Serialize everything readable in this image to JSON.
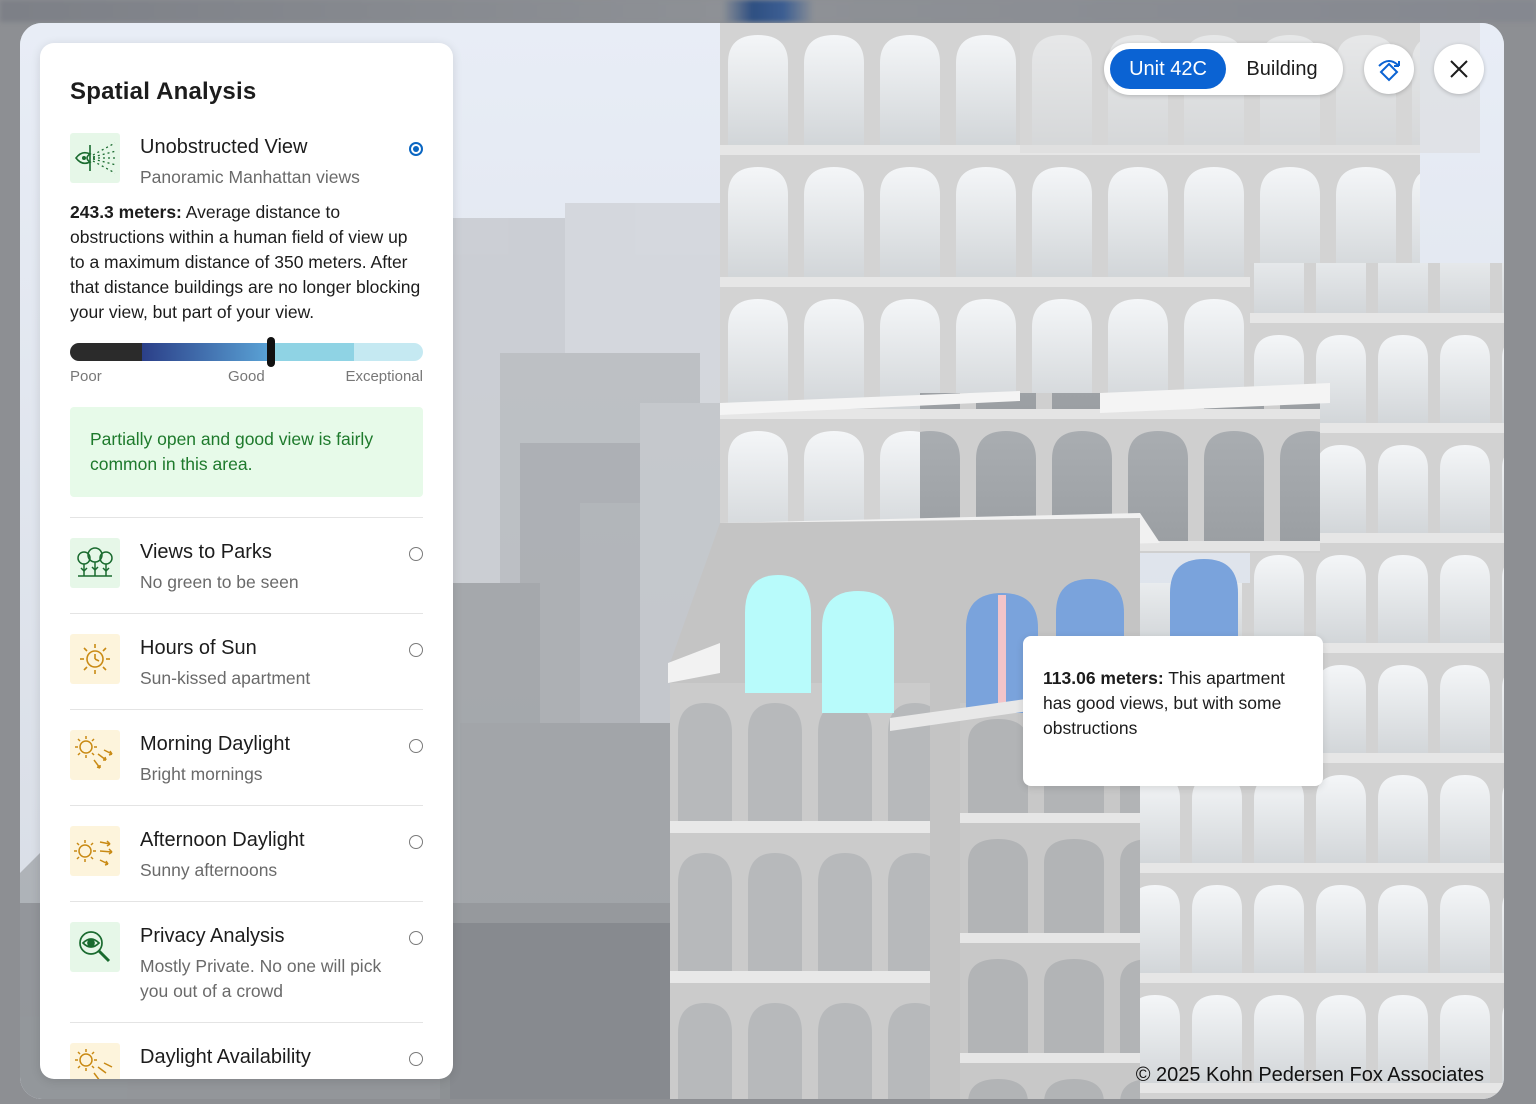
{
  "panel": {
    "title": "Spatial Analysis",
    "selected": {
      "label": "Unobstructed View",
      "sub": "Panoramic Manhattan views",
      "icon": "eye-view-icon",
      "metric": "243.3 meters:",
      "description": " Average distance to obstructions within a human field of view up to a maximum distance of 350 meters. After that distance buildings are no longer blocking your view, but part of your view.",
      "scale": {
        "labels": [
          "Poor",
          "Good",
          "Exceptional"
        ],
        "level_fraction": 0.57,
        "colors": [
          "#2b2b2b",
          "#2e4a9a",
          "#5aa3d6",
          "#8fd3e4",
          "#c5e9f2"
        ]
      },
      "note": "Partially open and good view is fairly common in this area."
    },
    "items": [
      {
        "label": "Views to Parks",
        "sub": "No green to be seen",
        "icon": "trees-icon"
      },
      {
        "label": "Hours of Sun",
        "sub": "Sun-kissed apartment",
        "icon": "sun-icon"
      },
      {
        "label": "Morning Daylight",
        "sub": "Bright mornings",
        "icon": "sun-rays-icon"
      },
      {
        "label": "Afternoon Daylight",
        "sub": "Sunny afternoons",
        "icon": "sun-rays-icon"
      },
      {
        "label": "Privacy Analysis",
        "sub": "Mostly Private. No one will pick you out of a crowd",
        "icon": "magnifier-eye-icon"
      },
      {
        "label": "Daylight Availability",
        "sub": "",
        "icon": "sun-rays-icon"
      }
    ]
  },
  "toggle": {
    "unit": "Unit 42C",
    "building": "Building",
    "active": "Unit 42C"
  },
  "tooltip": {
    "metric": "113.06 meters:",
    "text": " This apartment has good views, but with some obstructions"
  },
  "copyright": "© 2025 Kohn Pedersen Fox Associates",
  "colors": {
    "accent": "#0b63d3",
    "note_bg": "#e7fae9",
    "note_text": "#1e7a2c",
    "highlight_window": "#b8fbfb",
    "window_blue": "#7aa3dc"
  }
}
